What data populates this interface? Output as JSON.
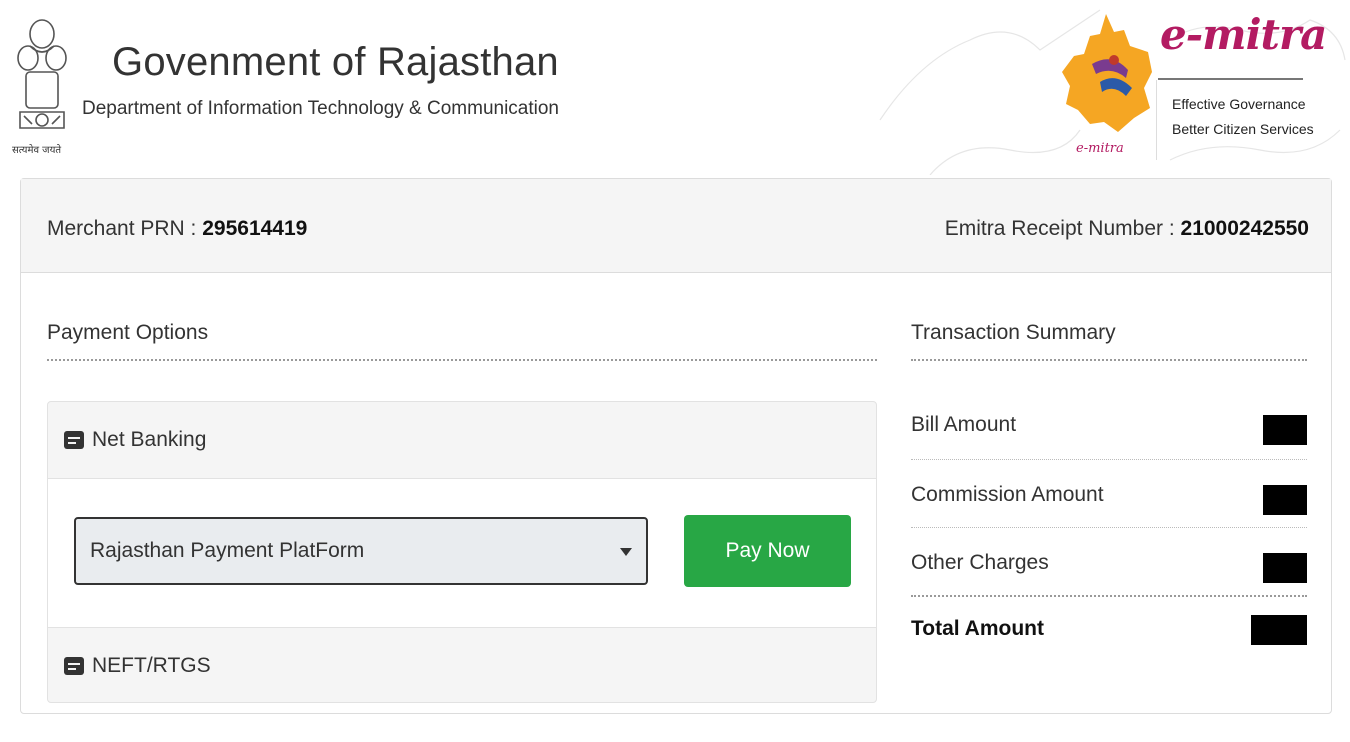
{
  "header": {
    "title": "Govenment of Rajasthan",
    "department": "Department of Information Technology & Communication",
    "emblem_motto": "सत्यमेव जयते",
    "brand": "e-mitra",
    "brand_small": "e-mitra",
    "tagline_1": "Effective Governance",
    "tagline_2": "Better Citizen Services"
  },
  "receipt_info": {
    "merchant_prn_label": "Merchant PRN :",
    "merchant_prn_value": "295614419",
    "emitra_receipt_label": "Emitra Receipt Number :",
    "emitra_receipt_value": "21000242550"
  },
  "payment": {
    "section_title": "Payment Options",
    "options": [
      {
        "label": "Net Banking",
        "icon": "card-icon"
      },
      {
        "label": "NEFT/RTGS",
        "icon": "card-icon"
      }
    ],
    "selected_gateway": "Rajasthan Payment PlatForm",
    "pay_button": "Pay Now"
  },
  "summary": {
    "section_title": "Transaction Summary",
    "rows": [
      {
        "label": "Bill Amount"
      },
      {
        "label": "Commission Amount"
      },
      {
        "label": "Other Charges"
      },
      {
        "label": "Total Amount"
      }
    ]
  },
  "colors": {
    "pay_button": "#28a745",
    "brand": "#b31b62",
    "logo_orange": "#f5a623"
  }
}
